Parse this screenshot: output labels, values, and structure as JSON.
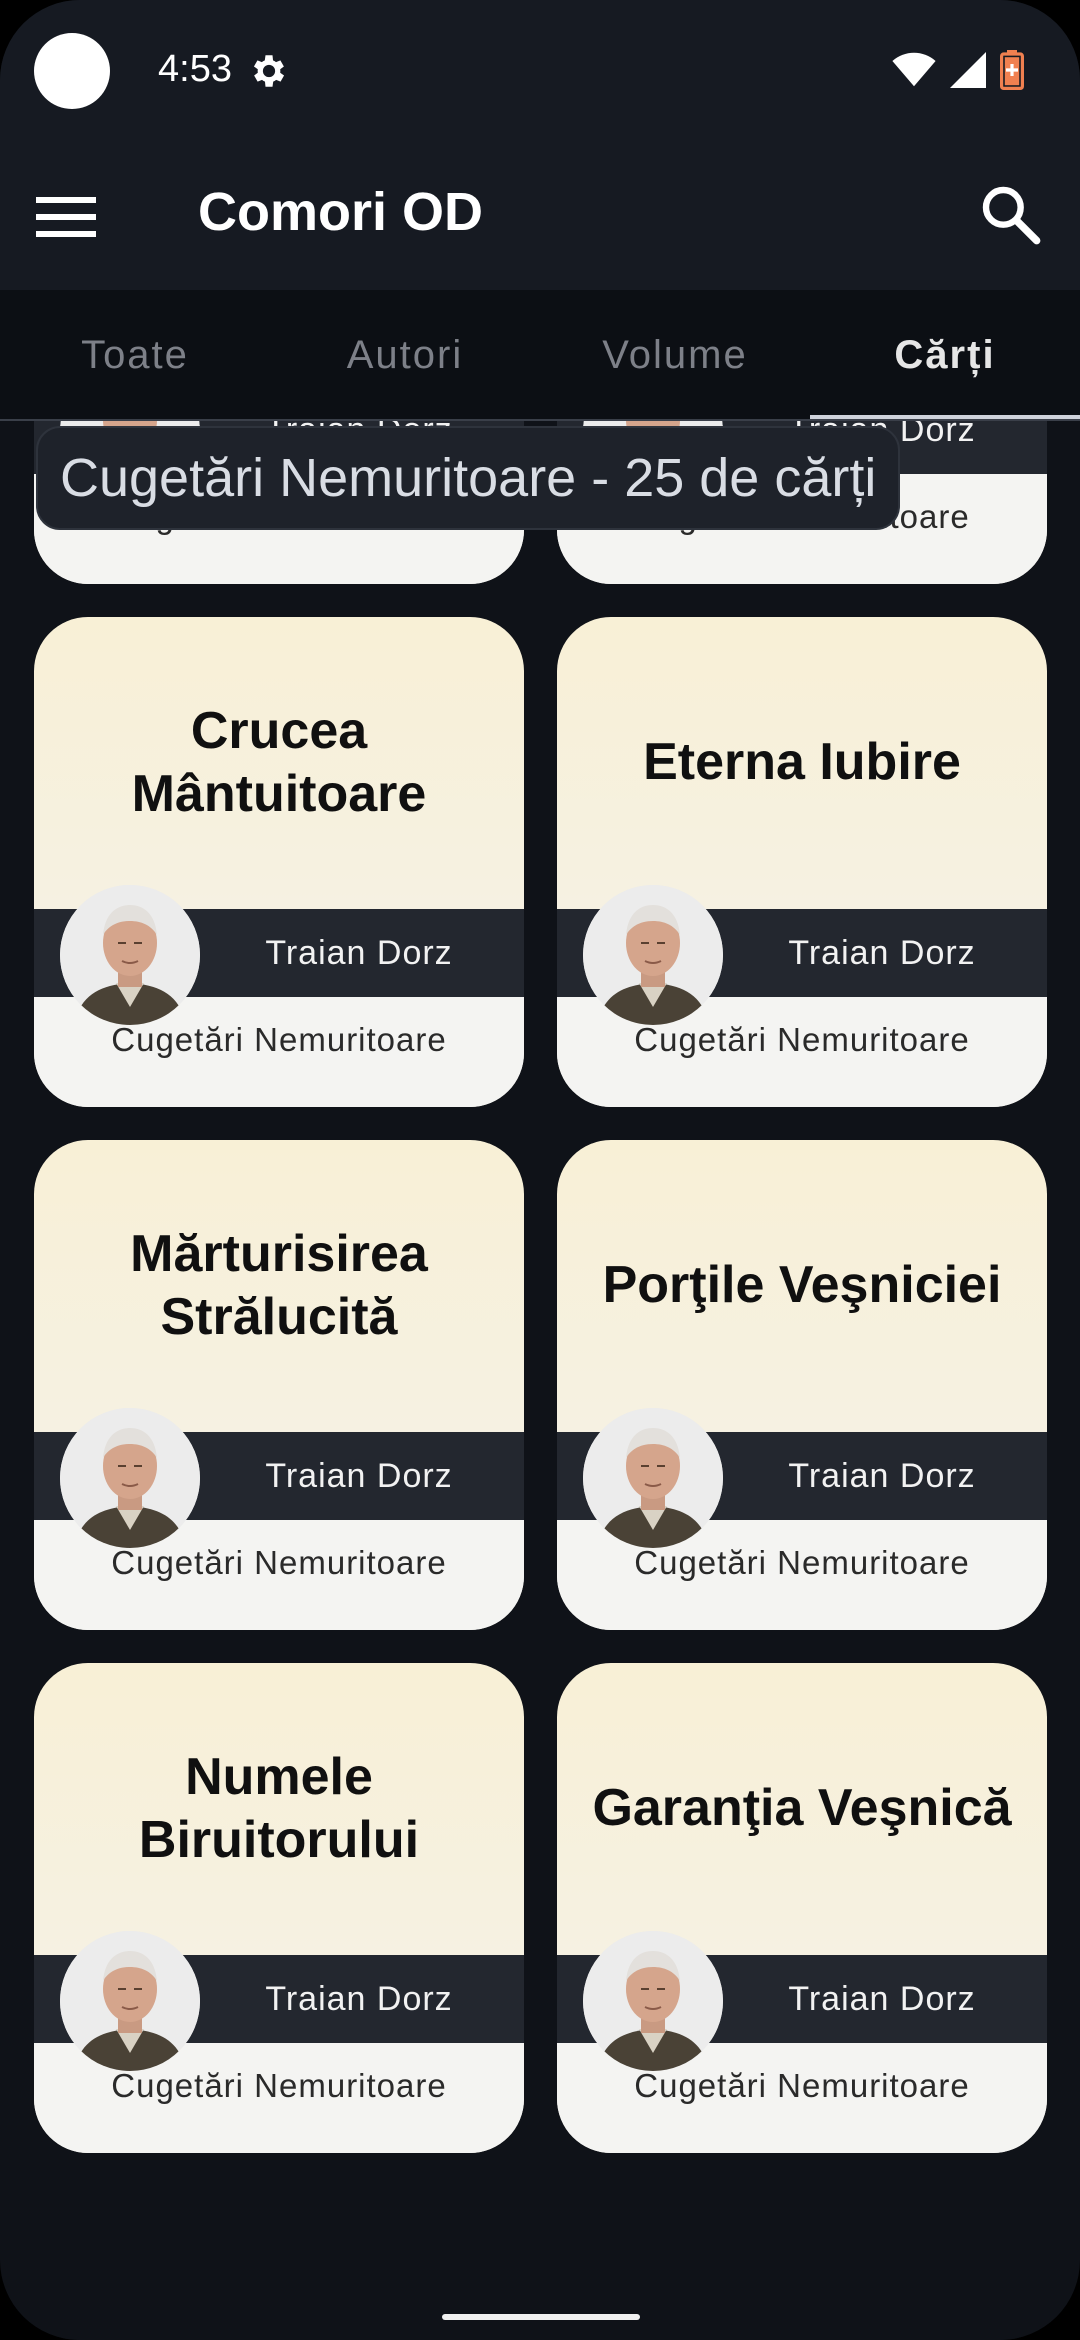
{
  "status_bar": {
    "time": "4:53"
  },
  "app_bar": {
    "title": "Comori OD"
  },
  "tabs": [
    {
      "label": "Toate"
    },
    {
      "label": "Autori"
    },
    {
      "label": "Volume"
    },
    {
      "label": "Cărți"
    }
  ],
  "active_tab": "Cărți",
  "toast": {
    "text": "Cugetări Nemuritoare - 25 de cărți"
  },
  "books": [
    {
      "title": "",
      "author": "Traian Dorz",
      "volume": "Cugetări Nemuritoare"
    },
    {
      "title": "",
      "author": "Traian Dorz",
      "volume": "Cugetări Nemuritoare"
    },
    {
      "title": "Crucea Mântuitoare",
      "author": "Traian Dorz",
      "volume": "Cugetări Nemuritoare"
    },
    {
      "title": "Eterna Iubire",
      "author": "Traian Dorz",
      "volume": "Cugetări Nemuritoare"
    },
    {
      "title": "Mărturisirea Strălucită",
      "author": "Traian Dorz",
      "volume": "Cugetări Nemuritoare"
    },
    {
      "title": "Porţile Veşniciei",
      "author": "Traian Dorz",
      "volume": "Cugetări Nemuritoare"
    },
    {
      "title": "Numele Biruitorului",
      "author": "Traian Dorz",
      "volume": "Cugetări Nemuritoare"
    },
    {
      "title": "Garanţia Veşnică",
      "author": "Traian Dorz",
      "volume": "Cugetări Nemuritoare"
    }
  ],
  "colors": {
    "background": "#0f1218",
    "bar": "#161a22",
    "card_top": "#f8f0d6",
    "author_band": "#23272f"
  },
  "icons": {
    "menu": "menu-icon",
    "search": "search-icon",
    "settings": "gear-icon",
    "wifi": "wifi-icon",
    "signal": "signal-icon",
    "battery": "battery-icon"
  }
}
